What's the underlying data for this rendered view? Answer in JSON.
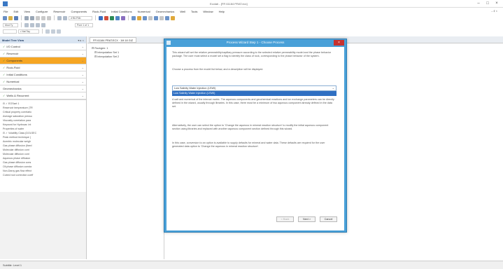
{
  "window": {
    "title": "Ecolab - [FR 61184 PRAT.ecx]",
    "controls": [
      "–",
      "□",
      "×"
    ]
  },
  "menu": {
    "items": [
      "File",
      "Edit",
      "View",
      "Configure",
      "Reservoir",
      "Components",
      "Rock-Fluid",
      "Initial Conditions",
      "Numerical",
      "Geomechanics",
      "Well",
      "Tools",
      "Window",
      "Help"
    ],
    "right": "– ♯ ×"
  },
  "toolbar": {
    "dropdown1": "•HM-FNb",
    "dropdown2": "Pore 1 of 1",
    "dropdown3": "Mod Ty",
    "dropdown4": "• Nat Tay"
  },
  "left_panel": {
    "title": "Model Tree View",
    "header_ctrls": "▾ ▸ ×",
    "sections": [
      {
        "label": "I/O Control",
        "active": false
      },
      {
        "label": "Reservoir",
        "active": false
      },
      {
        "label": "Components",
        "active": true
      },
      {
        "label": "Rock-Fluid",
        "active": false
      },
      {
        "label": "Initial Conditions",
        "active": false
      },
      {
        "label": "Numerical",
        "active": false
      },
      {
        "label": "Geomechanics",
        "active": false
      },
      {
        "label": "Wells & Recurrent",
        "active": false
      }
    ],
    "tree": [
      "⊟ ✓ EOSset 1",
      "    Reservoir temperature (TR",
      "    Critical property correlatio",
      "    Average saturation pressu",
      "    Viscosity correlation para",
      "    Keyword for Hydrocar. int",
      "    Properties of water",
      "⊟ ✓ Volatility Class (DOLSEC",
      "    Peak method technique (",
      "    Acentric molecular weigh",
      "    Gas phase diffusion (fixed",
      "    Molecular diffusion cont",
      "    Molecular diffusion cont",
      "    Aqueous phase diffusion",
      "    Gas phase diffusion cons",
      "    Oil phase diffusion consta",
      "    Non-Darcy gas flow effect",
      "    Cubed root correction coeff"
    ]
  },
  "doc_tab": "FR 61184 PRAT.ECX · 1M 18 GIZ",
  "center_tree": {
    "root": "⊟ Rockgen: 1",
    "children": [
      "⊟ Interpolation Set 1",
      "⊟ Interpolation Set 2"
    ]
  },
  "dialog": {
    "title": "Process Wizard Step 1 - Choose Process",
    "close": "×",
    "para1": "This wizard will set the relative permeability/capillary pressure according to the selected relative permeability model and the phase behavior package. The user must select a model set a flag to identify the class of rock, corresponding to the phase behavior of the system.",
    "para2": "Choose a process from the model list below, and a description will be displayed.",
    "select_value": "Low Salinity Water Injection (LSWI)",
    "dropdown_option": "Low Salinity Water Injection (LSWI)",
    "para3": "A salt and numerical of the interact matrix. The aqueous components and geochemical reactions and ion exchange parameters can be directly defined in the wizard, usually through libraries. In this case, there must be a minimum of two aqueous component already defined in the data set.",
    "para4": "Alternatively, the user can select the option to 'Change the aqueous in mineral reaction structure' to modify the initial aqueous component section using libraries and replaced with another aqueous component section defined through this wizard.",
    "para5": "In this case, conversion to an option is available to supply defaults for mineral and water data. These defaults are required for the user generated data option to 'Change the aqueous in mineral reaction structure'.",
    "buttons": {
      "back": "< Back",
      "next": "Next >",
      "cancel": "Cancel"
    }
  },
  "status": "Subtitle: Level 1"
}
